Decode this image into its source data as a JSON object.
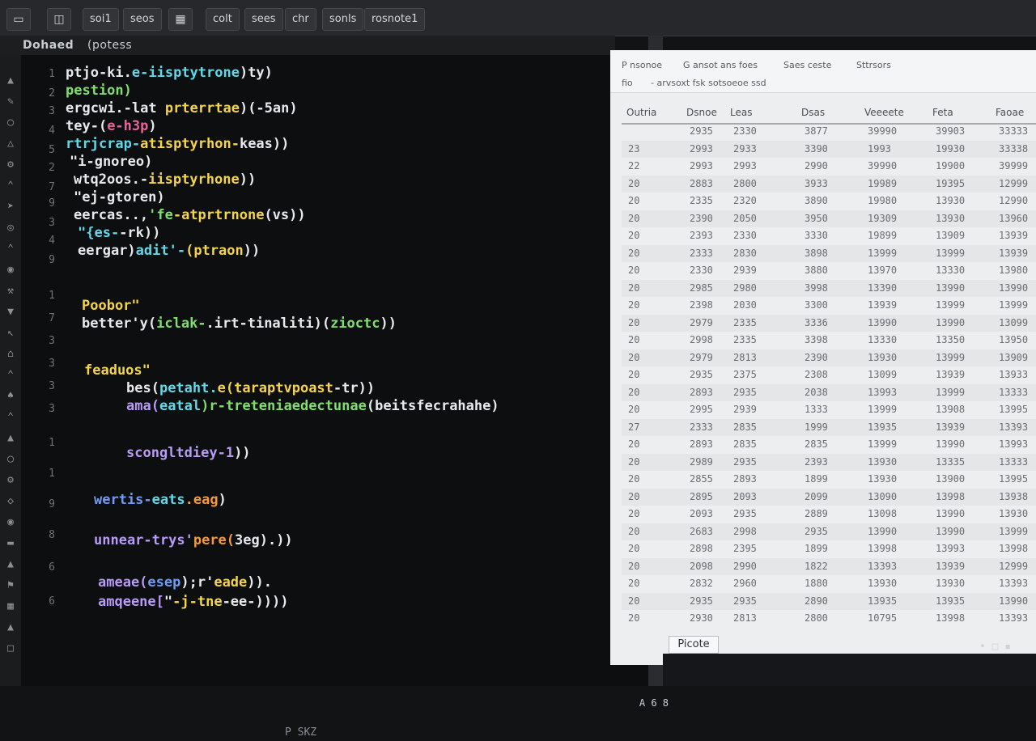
{
  "toolbar": {
    "items": [
      {
        "label": "",
        "icon": "tab-shape-icon"
      },
      {
        "label": "",
        "icon": "panel-icon"
      },
      {
        "label": "soi1"
      },
      {
        "label": "seos"
      },
      {
        "label": "",
        "icon": "grid-icon"
      },
      {
        "label": "colt"
      },
      {
        "label": "sees"
      },
      {
        "label": "chr"
      },
      {
        "label": "sonls"
      },
      {
        "label": "rosnote1"
      }
    ]
  },
  "panel": {
    "title": "Dohaed",
    "subtitle": "(potess"
  },
  "editor": {
    "line_numbers": [
      "1",
      "2",
      "3",
      "4",
      "5",
      "2",
      "7",
      "9",
      "3",
      "4",
      "9",
      "1",
      "7",
      "3",
      "3",
      "3",
      "3",
      "1",
      "1",
      "9",
      "8",
      "6",
      "6"
    ],
    "lines": [
      [
        {
          "t": "ptjo-ki.",
          "c": "w"
        },
        {
          "t": "e-iisptytrone",
          "c": "c"
        },
        {
          "t": ")ty)",
          "c": "w"
        }
      ],
      [
        {
          "t": "pestion)",
          "c": "g"
        }
      ],
      [
        {
          "t": "ergcwi.-lat ",
          "c": "w"
        },
        {
          "t": "prterrtae",
          "c": "y"
        },
        {
          "t": ")(-5an)",
          "c": "w"
        }
      ],
      [
        {
          "t": "tey-(",
          "c": "w"
        },
        {
          "t": "e-h3p",
          "c": "pk"
        },
        {
          "t": ")",
          "c": "w"
        }
      ],
      [
        {
          "t": "rtrjcrap-",
          "c": "c"
        },
        {
          "t": "atisptyrhon-",
          "c": "y"
        },
        {
          "t": "keas))",
          "c": "w"
        }
      ],
      [
        {
          "t": "\"i-gnoreo)",
          "c": "w"
        }
      ],
      [
        {
          "t": "wtq2oos.-",
          "c": "w"
        },
        {
          "t": "iisptyrhone",
          "c": "y"
        },
        {
          "t": "))",
          "c": "w"
        }
      ],
      [
        {
          "t": "\"ej-gtoren)",
          "c": "w"
        }
      ],
      [
        {
          "t": "eercas..,",
          "c": "w"
        },
        {
          "t": "'fe",
          "c": "g"
        },
        {
          "t": "-atprtrnone",
          "c": "y"
        },
        {
          "t": "(vs))",
          "c": "w"
        }
      ],
      [
        {
          "t": "\"{es-",
          "c": "c"
        },
        {
          "t": "-rk))",
          "c": "w"
        }
      ],
      [
        {
          "t": "eergar)",
          "c": "w"
        },
        {
          "t": "adit'-",
          "c": "c"
        },
        {
          "t": "(ptraon",
          "c": "y"
        },
        {
          "t": "))",
          "c": "w"
        }
      ],
      [
        {
          "t": "Poobor\"",
          "c": "y"
        }
      ],
      [
        {
          "t": "better'y(",
          "c": "w"
        },
        {
          "t": "iclak-",
          "c": "g"
        },
        {
          "t": ".irt-tinaliti)(",
          "c": "w"
        },
        {
          "t": "zioctc",
          "c": "g"
        },
        {
          "t": "))",
          "c": "w"
        }
      ],
      [
        {
          "t": "feaduos\"",
          "c": "y"
        }
      ],
      [
        {
          "t": "bes(",
          "c": "w"
        },
        {
          "t": "petaht.",
          "c": "c"
        },
        {
          "t": "e(taraptvpoast",
          "c": "y"
        },
        {
          "t": "-tr))",
          "c": "w"
        }
      ],
      [
        {
          "t": "ama(",
          "c": "p"
        },
        {
          "t": "eatal",
          "c": "c"
        },
        {
          "t": ")r-treteniaedectunae",
          "c": "g"
        },
        {
          "t": "(beitsfecrahahe)",
          "c": "w"
        }
      ],
      [
        {
          "t": "scongltdiey-1",
          "c": "p"
        },
        {
          "t": "))",
          "c": "w"
        }
      ],
      [
        {
          "t": "wertis-",
          "c": "b"
        },
        {
          "t": "eats",
          "c": "c"
        },
        {
          "t": ".eag",
          "c": "o"
        },
        {
          "t": ")",
          "c": "w"
        }
      ],
      [
        {
          "t": "unnear-trys'",
          "c": "p"
        },
        {
          "t": "pere(",
          "c": "o"
        },
        {
          "t": "3eg).))",
          "c": "w"
        }
      ],
      [
        {
          "t": "ameae(",
          "c": "p"
        },
        {
          "t": "esep",
          "c": "b"
        },
        {
          "t": ");r'",
          "c": "w"
        },
        {
          "t": "eade",
          "c": "y"
        },
        {
          "t": ")).",
          "c": "w"
        }
      ],
      [
        {
          "t": "amqeene[",
          "c": "p"
        },
        {
          "t": "\"",
          "c": "w"
        },
        {
          "t": "-j-tne",
          "c": "y"
        },
        {
          "t": "-ee-))))",
          "c": "w"
        }
      ]
    ],
    "status_text": "A 6 8",
    "bottom_text": "P SKZ"
  },
  "sheet": {
    "header_items": [
      "P nsonoe",
      "G ansot ans foes",
      "Saes ceste",
      "Sttrsors"
    ],
    "header_items2": [
      "fio",
      "- arvsoxt fsk sotsoeoe ssd"
    ],
    "columns": [
      "Outria",
      "Dsnoe",
      "Leas",
      "Dsas",
      "Veeeete",
      "Feta",
      "Faoae"
    ],
    "rows": [
      [
        "",
        "2935",
        "2330",
        "3877",
        "39990",
        "39903",
        "33333"
      ],
      [
        "23",
        "2993",
        "2933",
        "3390",
        "1993",
        "19930",
        "33338"
      ],
      [
        "22",
        "2993",
        "2993",
        "2990",
        "39990",
        "19900",
        "39999"
      ],
      [
        "20",
        "2883",
        "2800",
        "3933",
        "19989",
        "19395",
        "12999"
      ],
      [
        "20",
        "2335",
        "2320",
        "3890",
        "19980",
        "13930",
        "12990"
      ],
      [
        "20",
        "2390",
        "2050",
        "3950",
        "19309",
        "13930",
        "13960"
      ],
      [
        "20",
        "2393",
        "2330",
        "3330",
        "19899",
        "13909",
        "13939"
      ],
      [
        "20",
        "2333",
        "2830",
        "3898",
        "13999",
        "13999",
        "13939"
      ],
      [
        "20",
        "2330",
        "2939",
        "3880",
        "13970",
        "13330",
        "13980"
      ],
      [
        "20",
        "2985",
        "2980",
        "3998",
        "13390",
        "13990",
        "13990"
      ],
      [
        "20",
        "2398",
        "2030",
        "3300",
        "13939",
        "13999",
        "13999"
      ],
      [
        "20",
        "2979",
        "2335",
        "3336",
        "13990",
        "13990",
        "13099"
      ],
      [
        "20",
        "2998",
        "2335",
        "3398",
        "13330",
        "13350",
        "13950"
      ],
      [
        "20",
        "2979",
        "2813",
        "2390",
        "13930",
        "13999",
        "13909"
      ],
      [
        "20",
        "2935",
        "2375",
        "2308",
        "13099",
        "13939",
        "13933"
      ],
      [
        "20",
        "2893",
        "2935",
        "2038",
        "13993",
        "13999",
        "13333"
      ],
      [
        "20",
        "2995",
        "2939",
        "1333",
        "13999",
        "13908",
        "13995"
      ],
      [
        "27",
        "2333",
        "2835",
        "1999",
        "13935",
        "13939",
        "13393"
      ],
      [
        "20",
        "2893",
        "2835",
        "2835",
        "13999",
        "13990",
        "13993"
      ],
      [
        "20",
        "2989",
        "2935",
        "2393",
        "13930",
        "13335",
        "13333"
      ],
      [
        "20",
        "2855",
        "2893",
        "1899",
        "13930",
        "13900",
        "13995"
      ],
      [
        "20",
        "2895",
        "2093",
        "2099",
        "13090",
        "13998",
        "13938"
      ],
      [
        "20",
        "2093",
        "2935",
        "2889",
        "13098",
        "13990",
        "13930"
      ],
      [
        "20",
        "2683",
        "2998",
        "2935",
        "13990",
        "13990",
        "13999"
      ],
      [
        "20",
        "2898",
        "2395",
        "1899",
        "13998",
        "13993",
        "13998"
      ],
      [
        "20",
        "2098",
        "2990",
        "1822",
        "13393",
        "13939",
        "12999"
      ],
      [
        "20",
        "2832",
        "2960",
        "1880",
        "13930",
        "13930",
        "13393"
      ],
      [
        "20",
        "2935",
        "2935",
        "2890",
        "13935",
        "13935",
        "13990"
      ],
      [
        "20",
        "2930",
        "2813",
        "2800",
        "10795",
        "13998",
        "13393"
      ]
    ],
    "sheet_tab": "Picote",
    "status": "• □ ▪"
  }
}
